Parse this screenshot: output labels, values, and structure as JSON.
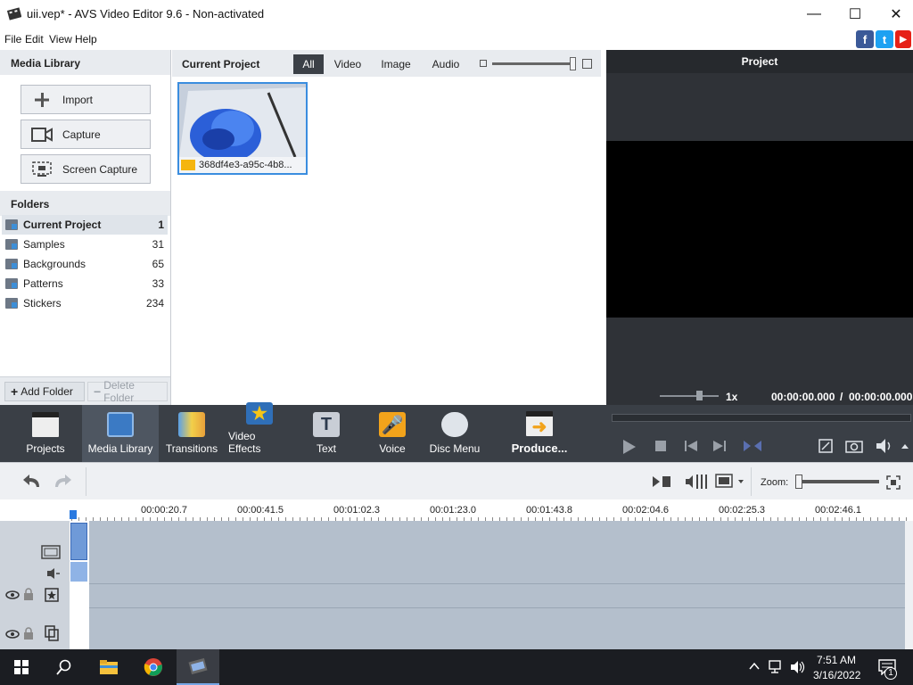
{
  "window": {
    "title": "uii.vep* - AVS Video Editor 9.6 - Non-activated",
    "minimize_glyph": "—",
    "maximize_glyph": "☐",
    "close_glyph": "✕"
  },
  "menu": {
    "file": "File",
    "edit": "Edit",
    "view": "View",
    "help": "Help"
  },
  "social": {
    "facebook": "f",
    "twitter": "t",
    "youtube": "▶"
  },
  "media_library": {
    "heading": "Media Library",
    "import_label": "Import",
    "capture_label": "Capture",
    "screen_capture_label": "Screen Capture"
  },
  "folders": {
    "heading": "Folders",
    "items": [
      {
        "name": "Current Project",
        "count": "1"
      },
      {
        "name": "Samples",
        "count": "31"
      },
      {
        "name": "Backgrounds",
        "count": "65"
      },
      {
        "name": "Patterns",
        "count": "33"
      },
      {
        "name": "Stickers",
        "count": "234"
      }
    ],
    "add_folder": "Add Folder",
    "delete_folder": "Delete Folder"
  },
  "content": {
    "heading": "Current Project",
    "filters": {
      "all": "All",
      "video": "Video",
      "image": "Image",
      "audio": "Audio"
    },
    "clip_name": "368df4e3-a95c-4b8..."
  },
  "preview": {
    "heading": "Project",
    "speed": "1x",
    "time_current": "00:00:00.000",
    "time_sep": "/",
    "time_total": "00:00:00.000"
  },
  "tools": {
    "projects": "Projects",
    "media_library": "Media Library",
    "transitions": "Transitions",
    "video_effects": "Video Effects",
    "text": "Text",
    "voice": "Voice",
    "disc_menu": "Disc Menu",
    "produce": "Produce..."
  },
  "timeline": {
    "zoom_label": "Zoom:",
    "ruler": [
      "00:00:20.7",
      "00:00:41.5",
      "00:01:02.3",
      "00:01:23.0",
      "00:01:43.8",
      "00:02:04.6",
      "00:02:25.3",
      "00:02:46.1"
    ]
  },
  "taskbar": {
    "time": "7:51 AM",
    "date": "3/16/2022",
    "notification_count": "1"
  },
  "colors": {
    "accent_blue": "#3a8ddf",
    "toolbar_dark": "#3a3f46",
    "preview_bg": "#2f3237",
    "track_bg": "#b4bfcc"
  }
}
